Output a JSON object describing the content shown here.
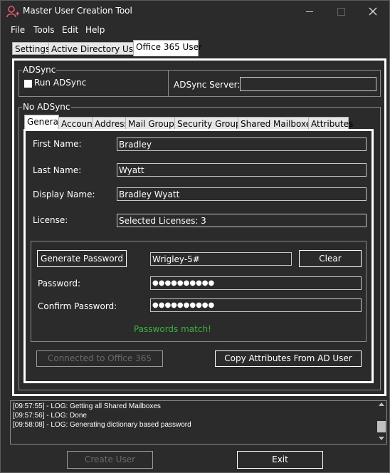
{
  "window": {
    "title": "Master User Creation Tool"
  },
  "menu": [
    "File",
    "Tools",
    "Edit",
    "Help"
  ],
  "tabs_top": [
    "Settings",
    "Active Directory User",
    "Office 365 User"
  ],
  "adsync": {
    "group_label": "ADSync",
    "run_label": "Run ADSync",
    "server_label": "ADSync Server:",
    "server_value": ""
  },
  "noadsync": {
    "group_label": "No ADSync"
  },
  "tabs_inner": [
    "General",
    "Account",
    "Address",
    "Mail Groups",
    "Security Groups",
    "Shared Mailboxes",
    "Attributes"
  ],
  "general": {
    "first_name_label": "First Name:",
    "first_name": "Bradley",
    "last_name_label": "Last Name:",
    "last_name": "Wyatt",
    "display_name_label": "Display Name:",
    "display_name": "Bradley Wyatt",
    "license_label": "License:",
    "license": "Selected Licenses: 3"
  },
  "password": {
    "generate_label": "Generate Password",
    "generated_value": "Wrigley-5#",
    "clear_label": "Clear",
    "password_label": "Password:",
    "password_mask": "●●●●●●●●●●",
    "confirm_label": "Confirm Password:",
    "confirm_mask": "●●●●●●●●●●",
    "status": "Passwords match!",
    "status_color": "#3cb043"
  },
  "actions": {
    "connect_label": "Connected to Office 365",
    "copy_label": "Copy Attributes From AD User"
  },
  "log": [
    "[09:57:55] - LOG: Getting all Shared Mailboxes",
    "[09:57:56] - LOG: Done",
    "[09:58:08] - LOG: Generating dictionary based password"
  ],
  "footer": {
    "create_label": "Create User",
    "exit_label": "Exit"
  }
}
